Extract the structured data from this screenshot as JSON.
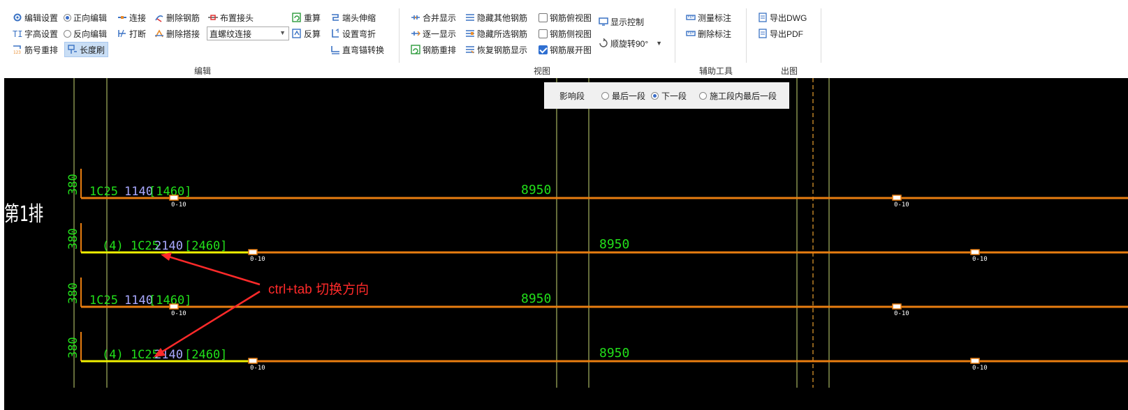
{
  "ribbon": {
    "groups": {
      "edit": "编辑",
      "view": "视图",
      "aux": "辅助工具",
      "output": "出图"
    },
    "edit": {
      "edit_settings": "编辑设置",
      "forward_edit": "正向编辑",
      "connect": "连接",
      "delete_rebar": "删除钢筋",
      "place_joint": "布置接头",
      "recalc": "重算",
      "end_stretch": "端头伸缩",
      "text_height": "字高设置",
      "reverse_edit": "反向编辑",
      "break": "打断",
      "delete_lap": "删除搭接",
      "joint_type_value": "直螺纹连接",
      "reverse_calc": "反算",
      "set_bend": "设置弯折",
      "straight_anchor": "直弯锚转换",
      "renumber": "筋号重排",
      "length_brush": "长度刷"
    },
    "view": {
      "merge_display": "合并显示",
      "hide_others": "隐藏其他钢筋",
      "top_view": "钢筋俯视图",
      "top_view_checked": false,
      "display_control": "显示控制",
      "one_by_one": "逐一显示",
      "hide_selected": "隐藏所选钢筋",
      "side_view": "钢筋侧视图",
      "side_view_checked": false,
      "rotate": "顺旋转90°",
      "rebar_rearrange": "钢筋重排",
      "restore_display": "恢复钢筋显示",
      "unfold_view": "钢筋展开图",
      "unfold_view_checked": true
    },
    "aux": {
      "measure": "测量标注",
      "delete_dim": "删除标注"
    },
    "output": {
      "export_dwg": "导出DWG",
      "export_pdf": "导出PDF"
    }
  },
  "segment_bar": {
    "label": "影响段",
    "options": [
      "最后一段",
      "下一段",
      "施工段内最后一段"
    ],
    "selected": "下一段"
  },
  "drawing": {
    "row_label": "第1排",
    "rows": [
      {
        "hook": "380",
        "spec": "1C25",
        "len": "1140",
        "total": "[1460]",
        "main_len": "8950",
        "joint_a": "0-10",
        "joint_b": "0-10"
      },
      {
        "hook": "380",
        "spec": "(4) 1C25",
        "len": "2140",
        "total": "[2460]",
        "main_len": "8950",
        "joint_a": "0-10",
        "joint_b": "0-10"
      },
      {
        "hook": "380",
        "spec": "1C25",
        "len": "1140",
        "total": "[1460]",
        "main_len": "8950",
        "joint_a": "0-10",
        "joint_b": "0-10"
      },
      {
        "hook": "380",
        "spec": "(4) 1C25",
        "len": "2140",
        "total": "[2460]",
        "main_len": "8950",
        "joint_a": "0-10",
        "joint_b": "0-10"
      }
    ],
    "annotation": "ctrl+tab 切换方向",
    "colors": {
      "bar": "#e87d10",
      "green": "#22e01a",
      "yellow": "#f0f000",
      "blue": "#a9a9ff",
      "annotation": "#ff2a2a",
      "guide": "#c8d873"
    }
  }
}
